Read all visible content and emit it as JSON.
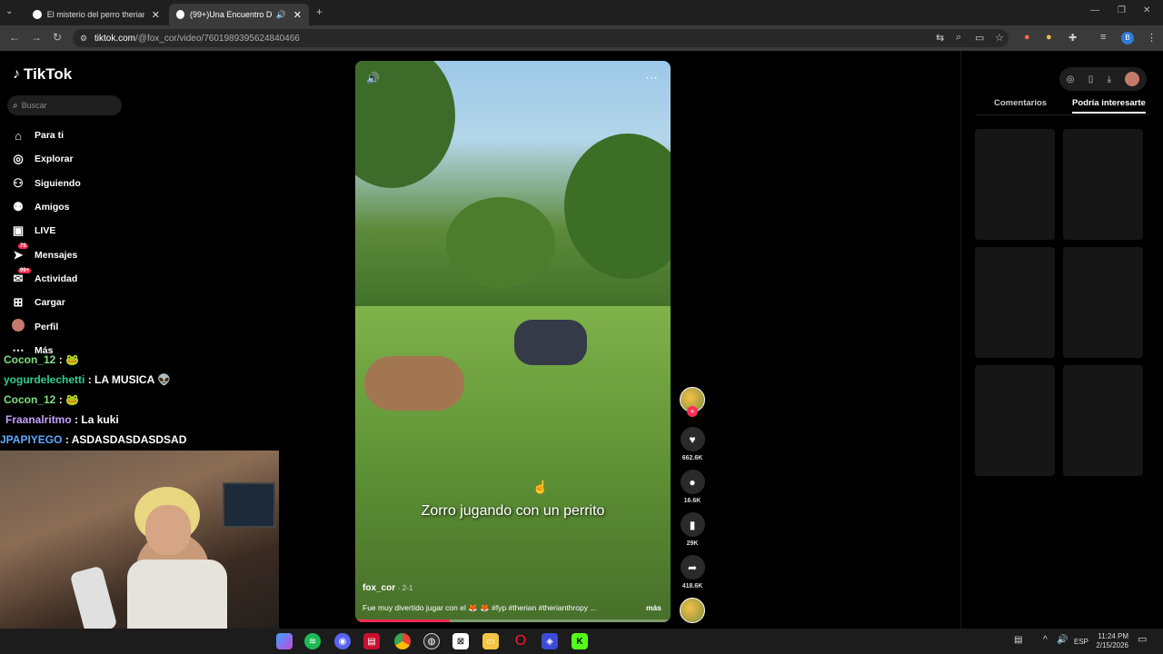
{
  "browser": {
    "tabs": [
      {
        "title": "El misterio del perro therian qu",
        "active": false
      },
      {
        "title": "(99+)Una Encuentro Diverti",
        "active": true
      }
    ],
    "url_host": "tiktok.com",
    "url_path": "/@fox_cor/video/7601989395624840466",
    "profile_initial": "B"
  },
  "sidebar": {
    "logo": "TikTok",
    "search_placeholder": "Buscar",
    "items": [
      {
        "label": "Para ti",
        "icon": "home-icon"
      },
      {
        "label": "Explorar",
        "icon": "compass-icon"
      },
      {
        "label": "Siguiendo",
        "icon": "following-icon"
      },
      {
        "label": "Amigos",
        "icon": "friends-icon"
      },
      {
        "label": "LIVE",
        "icon": "live-icon"
      },
      {
        "label": "Mensajes",
        "icon": "messages-icon",
        "badge": "75"
      },
      {
        "label": "Actividad",
        "icon": "activity-icon",
        "badge": "99+"
      },
      {
        "label": "Cargar",
        "icon": "upload-icon"
      },
      {
        "label": "Perfil",
        "icon": "profile-avatar"
      },
      {
        "label": "Más",
        "icon": "more-icon"
      }
    ]
  },
  "chat_overlay": [
    {
      "user": "Cocon_12",
      "message": ":",
      "color": "#7fe07f"
    },
    {
      "user": "yogurdelechetti",
      "message": ": LA MUSICA",
      "color": "#2fd08f"
    },
    {
      "user": "Cocon_12",
      "message": ":",
      "color": "#7fe07f"
    },
    {
      "user": "Fraanalritmo",
      "message": ": La kuki",
      "color": "#c3a0ff"
    },
    {
      "user": "JPAPIYEGO",
      "message": ": ASDASDASDASDSAD",
      "color": "#5ea8ff"
    }
  ],
  "video": {
    "caption": "Zorro jugando con un perrito",
    "author": "fox_cor",
    "date": "· 2-1",
    "description": "Fue muy divertido jugar con el 🦊 🦊 #fyp #therian #therianthropy ...",
    "more_label": "más",
    "progress": 0.3
  },
  "actions": {
    "likes": "662.6K",
    "comments": "16.6K",
    "saves": "29K",
    "shares": "418.6K"
  },
  "right_panel": {
    "tabs": [
      "Comentarios",
      "Podría interesarte"
    ],
    "active_tab": 1
  },
  "taskbar": {
    "lang": "ESP",
    "time": "11:24 PM",
    "date": "2/15/2026"
  }
}
